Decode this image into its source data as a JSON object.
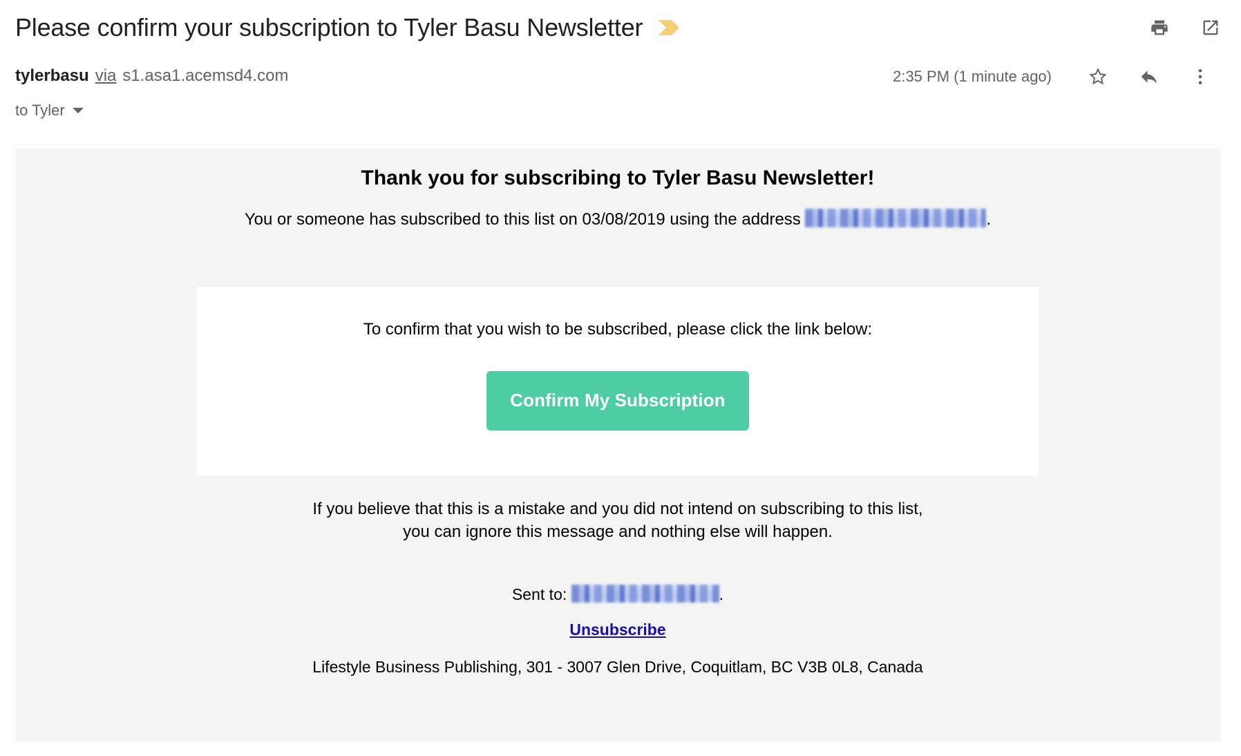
{
  "header": {
    "subject": "Please confirm your subscription to Tyler Basu Newsletter",
    "important_marker_icon": "yellow-chevron-icon",
    "important_marker_color": "#f3d077",
    "print_icon": "print-icon",
    "popout_icon": "open-in-new-window-icon"
  },
  "message_meta": {
    "sender_name": "tylerbasu",
    "via_label": "via",
    "via_domain": "s1.asa1.acemsd4.com",
    "timestamp": "2:35 PM (1 minute ago)",
    "star_icon": "star-outline-icon",
    "reply_icon": "reply-arrow-icon",
    "more_icon": "more-vertical-icon",
    "recipient": "to Tyler",
    "recipient_caret_icon": "chevron-down-icon"
  },
  "email": {
    "background_color": "#f4f4f4",
    "card_background_color": "#ffffff",
    "greeting": "Thank you for subscribing to Tyler Basu Newsletter!",
    "subscribe_note_prefix": "You or someone has subscribed to this list on 03/08/2019 using the address",
    "subscribe_date": "03/08/2019",
    "subscribe_note_suffix": ".",
    "redacted_address_label": "redacted-email-address",
    "card_instruction": "To confirm that you wish to be subscribed, please click the link below:",
    "cta_label": "Confirm My Subscription",
    "cta_color": "#4ecca3",
    "mistake_note_line1": "If you believe that this is a mistake and you did not intend on subscribing to this list,",
    "mistake_note_line2": "you can ignore this message and nothing else will happen.",
    "sent_to_label": "Sent to:",
    "sent_to_suffix": ".",
    "unsubscribe_label": "Unsubscribe",
    "unsubscribe_color": "#1a0dab",
    "postal_address": "Lifestyle Business Publishing, 301 - 3007 Glen Drive, Coquitlam, BC V3B 0L8, Canada"
  }
}
